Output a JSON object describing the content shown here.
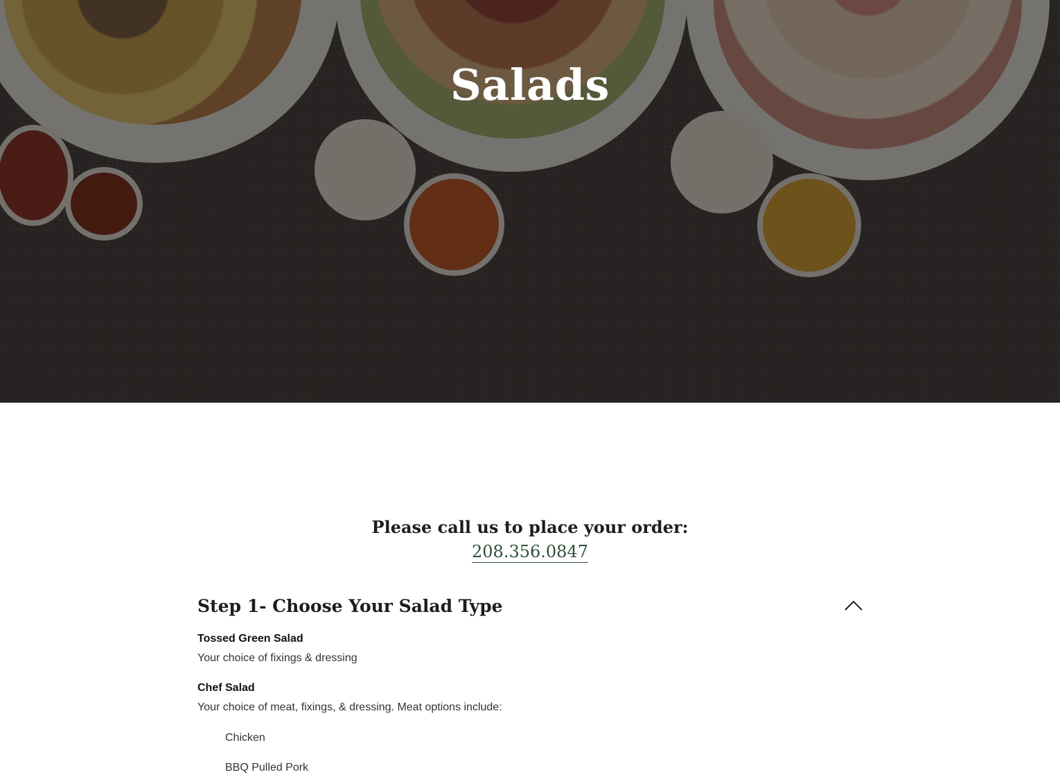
{
  "hero": {
    "title": "Salads"
  },
  "order": {
    "call_text": "Please call us to place your order:",
    "phone": "208.356.0847"
  },
  "section": {
    "title": "Step 1- Choose Your Salad Type",
    "toggle_icon": "chevron-up-icon",
    "items": [
      {
        "name": "Tossed Green Salad",
        "description": "Your choice of fixings & dressing"
      },
      {
        "name": "Chef Salad",
        "description": "Your choice of meat, fixings, & dressing. Meat options include:"
      }
    ],
    "meat_options": [
      "Chicken",
      "BBQ Pulled Pork"
    ]
  },
  "colors": {
    "link": "#2f4f3a",
    "heading": "#1d1d1d"
  }
}
